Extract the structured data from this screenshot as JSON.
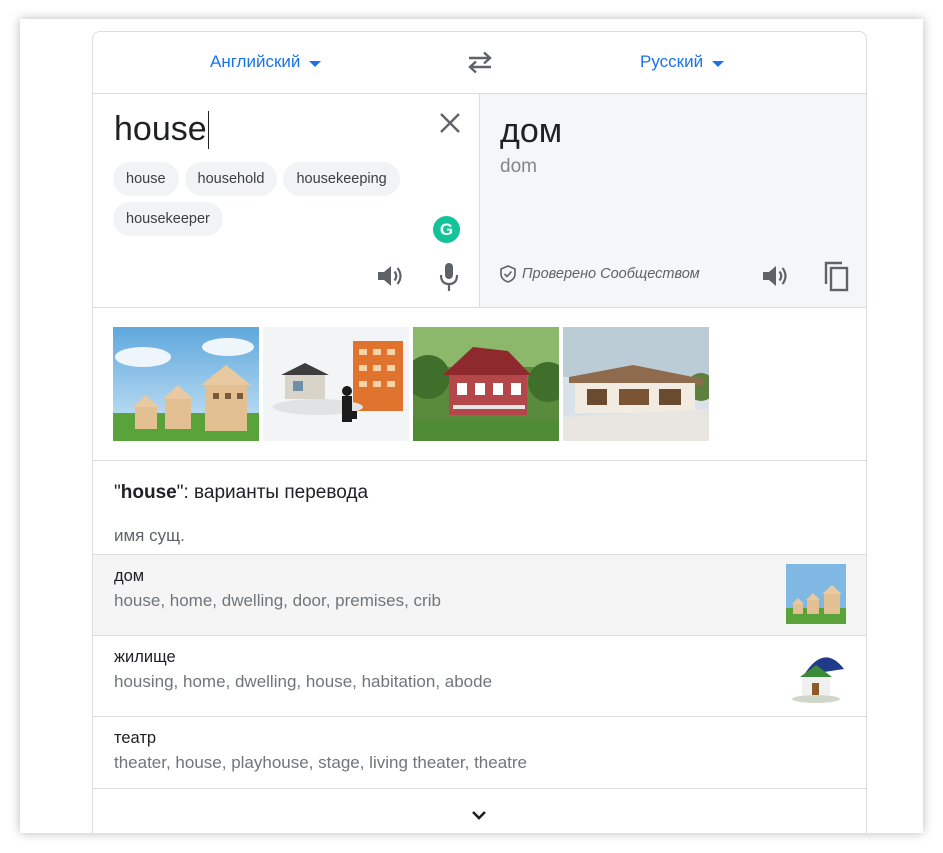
{
  "languages": {
    "source": "Английский",
    "target": "Русский"
  },
  "source": {
    "text": "house",
    "suggestions": [
      "house",
      "household",
      "housekeeping",
      "housekeeper"
    ]
  },
  "target": {
    "text": "дом",
    "transliteration": "dom",
    "verified_label": "Проверено Сообществом"
  },
  "icons": {
    "swap": "swap-icon",
    "clear": "close-icon",
    "grammarly": "grammarly-icon",
    "speaker": "speaker-icon",
    "mic": "microphone-icon",
    "copy": "copy-icon",
    "verified": "shield-check-icon",
    "expand": "chevron-down-icon"
  },
  "grammarly_letter": "G",
  "translations": {
    "heading_word": "house",
    "heading_rest": ": варианты перевода",
    "part_of_speech": "имя сущ.",
    "entries": [
      {
        "word": "дом",
        "synonyms": "house, home, dwelling, door, premises, crib"
      },
      {
        "word": "жилище",
        "synonyms": "housing, home, dwelling, house, habitation, abode"
      },
      {
        "word": "театр",
        "synonyms": "theater, house, playhouse, stage, living theater, theatre"
      }
    ]
  },
  "colors": {
    "accent": "#1a73e8",
    "grammarly": "#15c39a",
    "border": "#dadce0",
    "target_bg": "#f5f6f8"
  }
}
